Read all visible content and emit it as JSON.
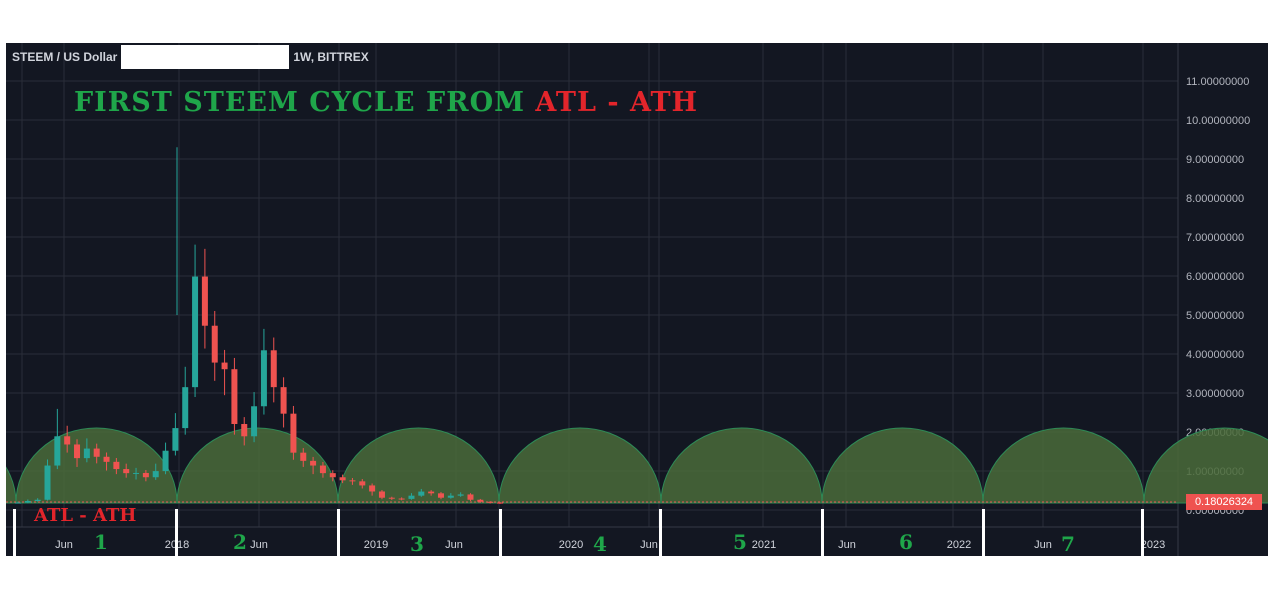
{
  "header": {
    "symbol": "STEEM / US Dollar",
    "interval_exchange": "1W, BITTREX"
  },
  "annotations": {
    "title_green": "FIRST STEEM CYCLE FROM ",
    "title_red": "ATL - ATH",
    "atl_label": "ATL - ATH",
    "cycle_numbers": [
      "1",
      "2",
      "3",
      "4",
      "5",
      "6",
      "7"
    ]
  },
  "price_tag": "0.18026324",
  "colors": {
    "background": "#131722",
    "up": "#26a69a",
    "down": "#ef5350",
    "arc_fill": "#4a6b3a",
    "arc_stroke": "#2e8b57",
    "annotation_green": "#1fa64a",
    "annotation_red": "#e3252b"
  },
  "chart_data": {
    "type": "candlestick",
    "title": "STEEM / US Dollar",
    "y_axis": {
      "ticks": [
        "11.00000000",
        "10.00000000",
        "9.00000000",
        "8.00000000",
        "7.00000000",
        "6.00000000",
        "5.00000000",
        "4.00000000",
        "3.00000000",
        "2.00000000",
        "1.00000000",
        "0.00000000"
      ],
      "ylim": [
        0,
        11.5
      ]
    },
    "x_axis": {
      "ticks": [
        "Jun",
        "2018",
        "Jun",
        "2019",
        "Jun",
        "2020",
        "Jun",
        "2021",
        "Jun",
        "2022",
        "Jun",
        "2023"
      ]
    },
    "cycle_boundaries": [
      "2016-07",
      "2017-12",
      "2018-10",
      "2019-08",
      "2020-06",
      "2021-04",
      "2022-02",
      "2022-12"
    ],
    "current_price": 0.18026324,
    "series_path_approx": [
      [
        0.2,
        0.18
      ],
      [
        0.25,
        0.22
      ],
      [
        0.28,
        0.25
      ],
      [
        1.2,
        1.0
      ],
      [
        2.4,
        1.8
      ],
      [
        2.0,
        1.6
      ],
      [
        1.4,
        1.2
      ],
      [
        1.7,
        1.5
      ],
      [
        1.5,
        1.3
      ],
      [
        1.3,
        1.1
      ],
      [
        1.2,
        1.0
      ],
      [
        1.1,
        0.9
      ],
      [
        1.0,
        0.85
      ],
      [
        0.9,
        0.8
      ],
      [
        1.1,
        0.95
      ],
      [
        1.6,
        1.3
      ],
      [
        2.3,
        2.0
      ],
      [
        3.4,
        3.0
      ],
      [
        6.3,
        5.0
      ],
      [
        6.2,
        4.5
      ],
      [
        4.0,
        3.6
      ],
      [
        3.8,
        3.2
      ],
      [
        2.6,
        2.1
      ],
      [
        2.0,
        1.8
      ],
      [
        2.8,
        2.4
      ],
      [
        4.3,
        3.9
      ],
      [
        3.5,
        3.0
      ],
      [
        2.6,
        2.3
      ],
      [
        1.6,
        1.4
      ],
      [
        1.4,
        1.2
      ],
      [
        1.2,
        1.0
      ],
      [
        1.0,
        0.9
      ],
      [
        0.9,
        0.8
      ],
      [
        0.8,
        0.75
      ],
      [
        0.75,
        0.7
      ],
      [
        0.7,
        0.6
      ],
      [
        0.5,
        0.4
      ],
      [
        0.35,
        0.3
      ],
      [
        0.3,
        0.28
      ],
      [
        0.3,
        0.27
      ],
      [
        0.4,
        0.35
      ],
      [
        0.5,
        0.45
      ],
      [
        0.45,
        0.4
      ],
      [
        0.35,
        0.3
      ],
      [
        0.4,
        0.35
      ],
      [
        0.42,
        0.38
      ],
      [
        0.3,
        0.25
      ],
      [
        0.22,
        0.2
      ],
      [
        0.2,
        0.18
      ],
      [
        0.18,
        0.17
      ]
    ]
  }
}
